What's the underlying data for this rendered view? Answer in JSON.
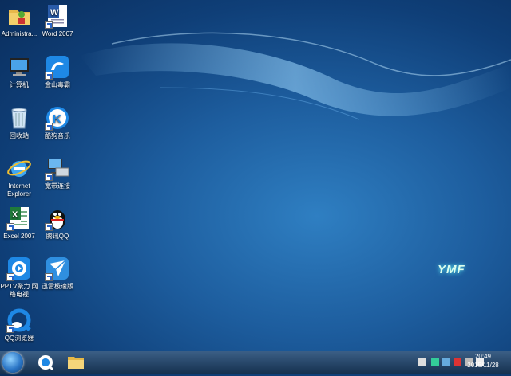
{
  "desktop": {
    "icons": [
      {
        "id": "administrator",
        "label": "Administra..."
      },
      {
        "id": "word2007",
        "label": "Word 2007"
      },
      {
        "id": "computer",
        "label": "计算机"
      },
      {
        "id": "kingsoft",
        "label": "金山毒霸"
      },
      {
        "id": "recycle",
        "label": "回收站"
      },
      {
        "id": "kugou",
        "label": "酷狗音乐"
      },
      {
        "id": "ie",
        "label": "Internet Explorer"
      },
      {
        "id": "broadband",
        "label": "宽带连接"
      },
      {
        "id": "excel2007",
        "label": "Excel 2007"
      },
      {
        "id": "qq",
        "label": "腾讯QQ"
      },
      {
        "id": "pptv",
        "label": "PPTV聚力 网络电视"
      },
      {
        "id": "xunlei",
        "label": "迅雷极速版"
      },
      {
        "id": "qqbrowser",
        "label": "QQ浏览器"
      }
    ]
  },
  "wallpaper": {
    "brand": "YMF"
  },
  "taskbar": {
    "pinned": [
      {
        "name": "qq-browser-icon"
      },
      {
        "name": "file-explorer-icon"
      }
    ],
    "clock": {
      "time": "20:49",
      "date": "2015/11/28"
    }
  },
  "colors": {
    "accent": "#1d5d9e",
    "taskbar": "#16314f"
  }
}
